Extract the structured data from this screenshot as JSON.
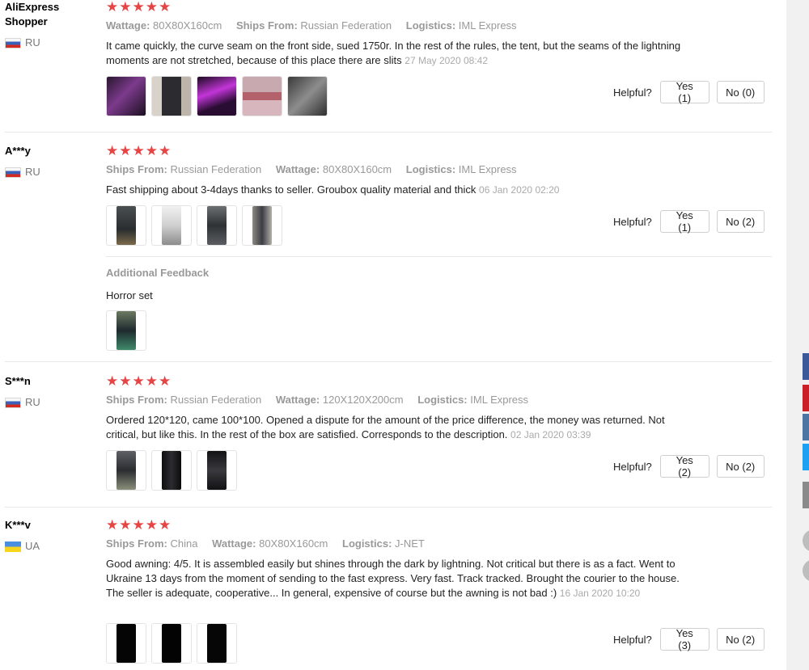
{
  "reviews": [
    {
      "user": "AliExpress Shopper",
      "country": "RU",
      "flag": "ru",
      "stars": "★★★★★",
      "meta": [
        {
          "key": "Wattage:",
          "value": "80X80X160cm"
        },
        {
          "key": "Ships From:",
          "value": "Russian Federation"
        },
        {
          "key": "Logistics:",
          "value": "IML Express"
        }
      ],
      "text": "It came quickly, the curve seam on the front side, sued 1750r. In the rest of the rules, the tent, but the seams of the lightning moments are not stretched, because of this place there are slits",
      "date": "27 May 2020 08:42",
      "helpful_label": "Helpful?",
      "yes": "Yes (1)",
      "no": "No (0)"
    },
    {
      "user": "A***y",
      "country": "RU",
      "flag": "ru",
      "stars": "★★★★★",
      "meta": [
        {
          "key": "Ships From:",
          "value": "Russian Federation"
        },
        {
          "key": "Wattage:",
          "value": "80X80X160cm"
        },
        {
          "key": "Logistics:",
          "value": "IML Express"
        }
      ],
      "text": "Fast shipping about 3-4days thanks to seller. Groubox quality material and thick",
      "date": "06 Jan 2020 02:20",
      "helpful_label": "Helpful?",
      "yes": "Yes (1)",
      "no": "No (2)",
      "additional_title": "Additional Feedback",
      "additional_text": "Horror set"
    },
    {
      "user": "S***n",
      "country": "RU",
      "flag": "ru",
      "stars": "★★★★★",
      "meta": [
        {
          "key": "Ships From:",
          "value": "Russian Federation"
        },
        {
          "key": "Wattage:",
          "value": "120X120X200cm"
        },
        {
          "key": "Logistics:",
          "value": "IML Express"
        }
      ],
      "text": "Ordered 120*120, came 100*100. Opened a dispute for the amount of the price difference, the money was returned. Not critical, but like this. In the rest of the box are satisfied. Corresponds to the description.",
      "date": "02 Jan 2020 03:39",
      "helpful_label": "Helpful?",
      "yes": "Yes (2)",
      "no": "No (2)"
    },
    {
      "user": "K***v",
      "country": "UA",
      "flag": "ua",
      "stars": "★★★★★",
      "meta": [
        {
          "key": "Ships From:",
          "value": "China"
        },
        {
          "key": "Wattage:",
          "value": "80X80X160cm"
        },
        {
          "key": "Logistics:",
          "value": "J-NET"
        }
      ],
      "text": "Good awning: 4/5. It is assembled easily but shines through the dark by lightning. Not critical but there is as a fact. Went to Ukraine 13 days from the moment of sending to the fast express. Very fast. Track tracked. Brought the courier to the house. The seller is adequate, cooperative... In general, expensive of course but the awning is not bad :)",
      "date": "16 Jan 2020 10:20",
      "helpful_label": "Helpful?",
      "yes": "Yes (3)",
      "no": "No (2)"
    }
  ],
  "share_colors": [
    "#3b5998",
    "#cb2027",
    "#4c75a3",
    "#1da1f2",
    "#8a8a8a"
  ]
}
